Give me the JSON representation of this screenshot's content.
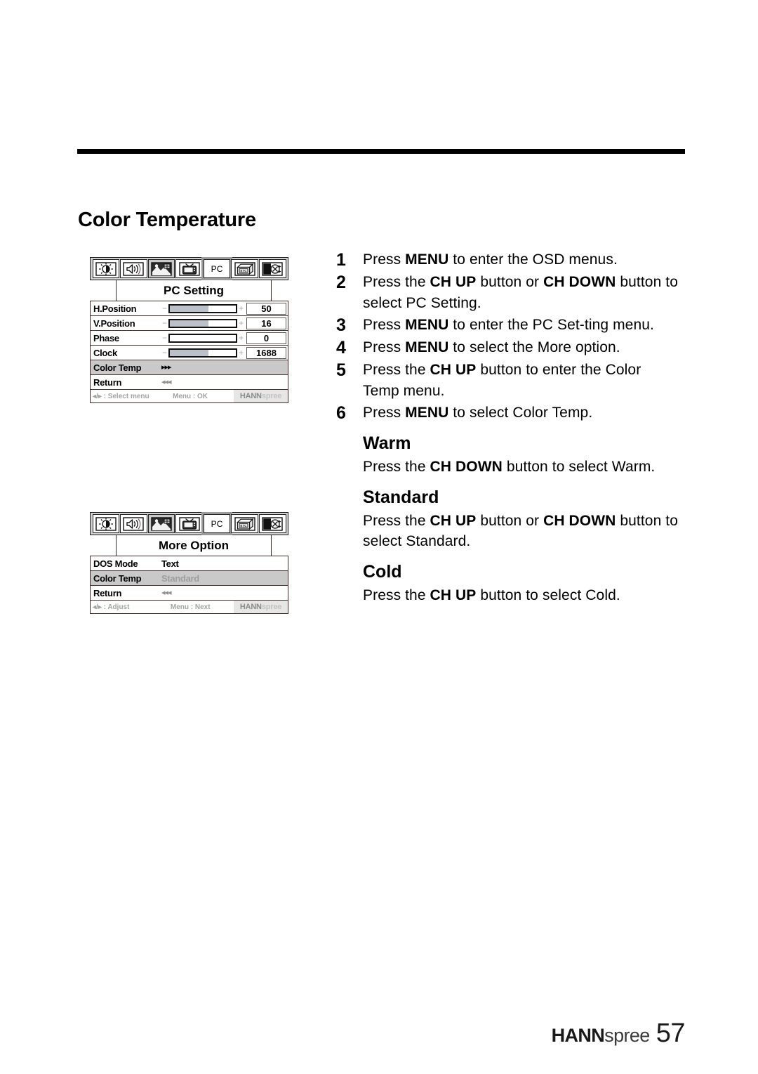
{
  "page": {
    "title": "Color Temperature",
    "number": "57",
    "brand": {
      "bold": "HANN",
      "light": "spree"
    }
  },
  "osd_menus": [
    {
      "name": "pc-setting",
      "title": "PC Setting",
      "icons": [
        {
          "name": "brightness-contrast-icon",
          "state": "normal"
        },
        {
          "name": "volume-speaker-icon",
          "state": "normal"
        },
        {
          "name": "picture-image-icon",
          "state": "dim"
        },
        {
          "name": "tv-icon",
          "state": "normal"
        },
        {
          "name": "pc-icon",
          "label": "PC",
          "state": "selected"
        },
        {
          "name": "etc-box-icon",
          "label": "ETC",
          "state": "normal"
        },
        {
          "name": "source-input-icon",
          "state": "normal"
        }
      ],
      "rows": [
        {
          "label": "H.Position",
          "type": "slider",
          "fill": 58,
          "value": "50"
        },
        {
          "label": "V.Position",
          "type": "slider",
          "fill": 58,
          "value": "16"
        },
        {
          "label": "Phase",
          "type": "slider",
          "fill": 0,
          "value": "0"
        },
        {
          "label": "Clock",
          "type": "slider",
          "fill": 58,
          "value": "1688"
        },
        {
          "label": "Color Temp",
          "type": "arrows-right",
          "arrows": "▸▸▸",
          "highlight": true
        },
        {
          "label": "Return",
          "type": "arrows-left",
          "arrows": "◂◂◂",
          "highlight": false
        }
      ],
      "status": {
        "left": "◂/▸ : Select menu",
        "mid": "Menu : OK"
      },
      "slider_minus": "−",
      "slider_plus": "+"
    },
    {
      "name": "more-option",
      "title": "More Option",
      "icons": [
        {
          "name": "brightness-contrast-icon",
          "state": "normal"
        },
        {
          "name": "volume-speaker-icon",
          "state": "normal"
        },
        {
          "name": "picture-image-icon",
          "state": "dim"
        },
        {
          "name": "tv-icon",
          "state": "normal"
        },
        {
          "name": "pc-icon",
          "label": "PC",
          "state": "selected"
        },
        {
          "name": "etc-box-icon",
          "label": "ETC",
          "state": "normal"
        },
        {
          "name": "source-input-icon",
          "state": "normal"
        }
      ],
      "rows": [
        {
          "label": "DOS Mode",
          "type": "text",
          "value": "Text",
          "highlight": false,
          "dim": false
        },
        {
          "label": "Color Temp",
          "type": "text",
          "value": "Standard",
          "highlight": true,
          "dim": true
        },
        {
          "label": "Return",
          "type": "arrows-left",
          "arrows": "◂◂◂",
          "highlight": false
        }
      ],
      "status": {
        "left": "◂/▸ : Adjust",
        "mid": "Menu : Next"
      }
    }
  ],
  "steps": [
    {
      "num": "1",
      "parts": [
        {
          "t": "Press ",
          "b": false
        },
        {
          "t": "MENU",
          "b": true
        },
        {
          "t": " to enter the OSD menus.",
          "b": false
        }
      ]
    },
    {
      "num": "2",
      "parts": [
        {
          "t": "Press the ",
          "b": false
        },
        {
          "t": "CH UP",
          "b": true
        },
        {
          "t": " button or ",
          "b": false
        },
        {
          "t": "CH DOWN",
          "b": true
        },
        {
          "t": " button to select PC Setting.",
          "b": false
        }
      ]
    },
    {
      "num": "3",
      "parts": [
        {
          "t": "Press ",
          "b": false
        },
        {
          "t": "MENU",
          "b": true
        },
        {
          "t": " to enter the PC Set-ting menu.",
          "b": false
        }
      ]
    },
    {
      "num": "4",
      "parts": [
        {
          "t": "Press ",
          "b": false
        },
        {
          "t": "MENU",
          "b": true
        },
        {
          "t": " to select the More option.",
          "b": false
        }
      ]
    },
    {
      "num": "5",
      "parts": [
        {
          "t": "Press the ",
          "b": false
        },
        {
          "t": "CH UP",
          "b": true
        },
        {
          "t": " button to enter the Color Temp menu.",
          "b": false
        }
      ]
    },
    {
      "num": "6",
      "parts": [
        {
          "t": "Press ",
          "b": false
        },
        {
          "t": "MENU",
          "b": true
        },
        {
          "t": " to select Color Temp.",
          "b": false
        }
      ]
    }
  ],
  "sections": [
    {
      "heading": "Warm",
      "parts": [
        {
          "t": "Press the ",
          "b": false
        },
        {
          "t": "CH DOWN",
          "b": true
        },
        {
          "t": " button to select Warm.",
          "b": false
        }
      ]
    },
    {
      "heading": "Standard",
      "parts": [
        {
          "t": "Press the ",
          "b": false
        },
        {
          "t": "CH UP",
          "b": true
        },
        {
          "t": " button or ",
          "b": false
        },
        {
          "t": "CH DOWN",
          "b": true
        },
        {
          "t": " button to select Standard.",
          "b": false
        }
      ]
    },
    {
      "heading": "Cold",
      "parts": [
        {
          "t": "Press the ",
          "b": false
        },
        {
          "t": "CH UP",
          "b": true
        },
        {
          "t": " button to select Cold.",
          "b": false
        }
      ]
    }
  ]
}
